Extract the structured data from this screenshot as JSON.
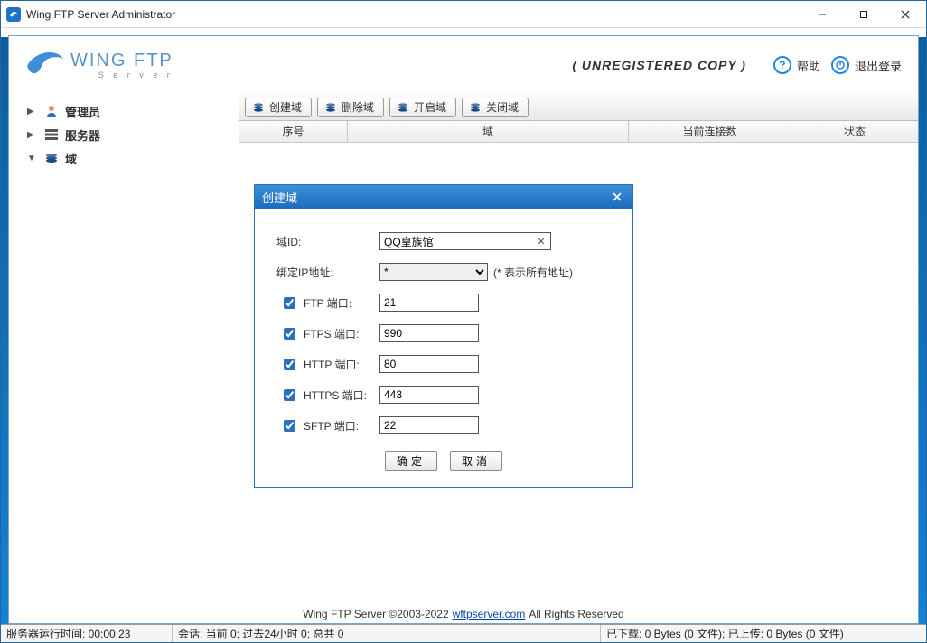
{
  "window": {
    "title": "Wing FTP Server Administrator"
  },
  "logo": {
    "line1": "WING FTP",
    "line2": "S e r v e r"
  },
  "header": {
    "unregistered": "( UNREGISTERED COPY )",
    "help": "帮助",
    "logout": "退出登录"
  },
  "sidebar": {
    "items": [
      {
        "label": "管理员"
      },
      {
        "label": "服务器"
      },
      {
        "label": "域"
      }
    ]
  },
  "toolbar": {
    "create": "创建域",
    "delete": "删除域",
    "start": "开启域",
    "stop": "关闭域"
  },
  "grid": {
    "cols": {
      "seq": "序号",
      "domain": "域",
      "connections": "当前连接数",
      "status": "状态"
    }
  },
  "dialog": {
    "title": "创建域",
    "domain_id_label": "域ID:",
    "domain_id_value": "QQ皇族馆",
    "bind_ip_label": "绑定IP地址:",
    "bind_ip_value": "*",
    "bind_ip_hint": "(* 表示所有地址)",
    "ports": [
      {
        "label": "FTP 端口:",
        "value": "21"
      },
      {
        "label": "FTPS 端口:",
        "value": "990"
      },
      {
        "label": "HTTP 端口:",
        "value": "80"
      },
      {
        "label": "HTTPS 端口:",
        "value": "443"
      },
      {
        "label": "SFTP 端口:",
        "value": "22"
      }
    ],
    "ok": "确定",
    "cancel": "取消"
  },
  "footer": {
    "prefix": "Wing FTP Server ©2003-2022 ",
    "link": "wftpserver.com",
    "suffix": " All Rights Reserved"
  },
  "statusbar": {
    "uptime": "服务器运行时间: 00:00:23",
    "sessions": "会话: 当前 0;  过去24小时 0;  总共 0",
    "transfer": "已下载: 0 Bytes (0 文件);  已上传: 0 Bytes (0 文件)"
  }
}
